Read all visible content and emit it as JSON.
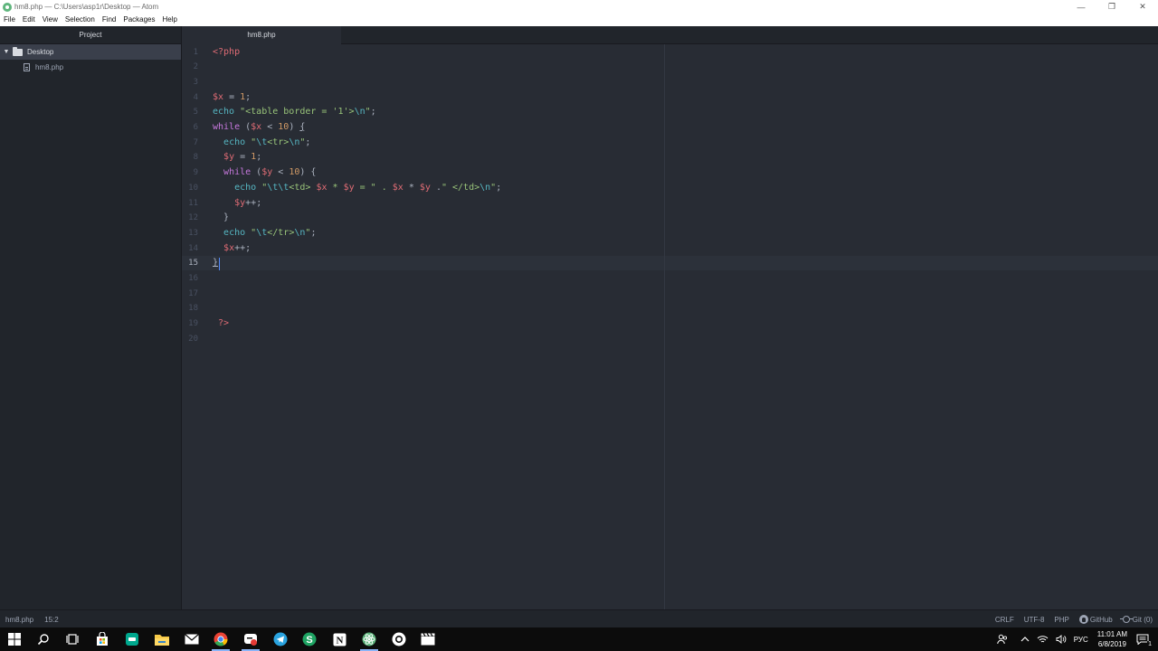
{
  "window": {
    "title": "hm8.php — C:\\Users\\asp1r\\Desktop — Atom",
    "controls": [
      "—",
      "❐",
      "✕"
    ]
  },
  "menu": [
    "File",
    "Edit",
    "View",
    "Selection",
    "Find",
    "Packages",
    "Help"
  ],
  "sidebar": {
    "header": "Project",
    "root": "Desktop",
    "files": [
      "hm8.php"
    ]
  },
  "tabs": [
    {
      "label": "hm8.php",
      "active": true
    }
  ],
  "editor": {
    "line_numbers": [
      "1",
      "2",
      "3",
      "4",
      "5",
      "6",
      "7",
      "8",
      "9",
      "10",
      "11",
      "12",
      "13",
      "14",
      "15",
      "16",
      "17",
      "18",
      "19",
      "20"
    ],
    "active_line": 15,
    "lines": [
      [
        [
          "tag",
          "<?php"
        ]
      ],
      [],
      [],
      [
        [
          "var",
          "$x"
        ],
        [
          "op",
          " = "
        ],
        [
          "num",
          "1"
        ],
        [
          "punc",
          ";"
        ]
      ],
      [
        [
          "fn",
          "echo"
        ],
        [
          "op",
          " "
        ],
        [
          "str",
          "\"<table border = '1'>"
        ],
        [
          "esc",
          "\\n"
        ],
        [
          "str",
          "\""
        ],
        [
          "punc",
          ";"
        ]
      ],
      [
        [
          "kw",
          "while"
        ],
        [
          "op",
          " ("
        ],
        [
          "var",
          "$x"
        ],
        [
          "op",
          " < "
        ],
        [
          "num",
          "10"
        ],
        [
          "op",
          ") "
        ],
        [
          "brace-m",
          "{"
        ]
      ],
      [
        [
          "op",
          "  "
        ],
        [
          "fn",
          "echo"
        ],
        [
          "op",
          " "
        ],
        [
          "str",
          "\""
        ],
        [
          "esc",
          "\\t"
        ],
        [
          "str",
          "<tr>"
        ],
        [
          "esc",
          "\\n"
        ],
        [
          "str",
          "\""
        ],
        [
          "punc",
          ";"
        ]
      ],
      [
        [
          "op",
          "  "
        ],
        [
          "var",
          "$y"
        ],
        [
          "op",
          " = "
        ],
        [
          "num",
          "1"
        ],
        [
          "punc",
          ";"
        ]
      ],
      [
        [
          "op",
          "  "
        ],
        [
          "kw",
          "while"
        ],
        [
          "op",
          " ("
        ],
        [
          "var",
          "$y"
        ],
        [
          "op",
          " < "
        ],
        [
          "num",
          "10"
        ],
        [
          "op",
          ") {"
        ]
      ],
      [
        [
          "op",
          "    "
        ],
        [
          "fn",
          "echo"
        ],
        [
          "op",
          " "
        ],
        [
          "str",
          "\""
        ],
        [
          "esc",
          "\\t\\t"
        ],
        [
          "str",
          "<td> "
        ],
        [
          "var",
          "$x"
        ],
        [
          "str",
          " * "
        ],
        [
          "var",
          "$y"
        ],
        [
          "str",
          " = \" . "
        ],
        [
          "var",
          "$x"
        ],
        [
          "op",
          " * "
        ],
        [
          "var",
          "$y"
        ],
        [
          "op",
          " ."
        ],
        [
          "str",
          "\" </td>"
        ],
        [
          "esc",
          "\\n"
        ],
        [
          "str",
          "\""
        ],
        [
          "punc",
          ";"
        ]
      ],
      [
        [
          "op",
          "    "
        ],
        [
          "var",
          "$y"
        ],
        [
          "op",
          "++"
        ],
        [
          "punc",
          ";"
        ]
      ],
      [
        [
          "op",
          "  }"
        ]
      ],
      [
        [
          "op",
          "  "
        ],
        [
          "fn",
          "echo"
        ],
        [
          "op",
          " "
        ],
        [
          "str",
          "\""
        ],
        [
          "esc",
          "\\t"
        ],
        [
          "str",
          "</tr>"
        ],
        [
          "esc",
          "\\n"
        ],
        [
          "str",
          "\""
        ],
        [
          "punc",
          ";"
        ]
      ],
      [
        [
          "op",
          "  "
        ],
        [
          "var",
          "$x"
        ],
        [
          "op",
          "++"
        ],
        [
          "punc",
          ";"
        ]
      ],
      [
        [
          "brace-m",
          "}"
        ]
      ],
      [],
      [],
      [],
      [
        [
          "op",
          " "
        ],
        [
          "tag",
          "?>"
        ]
      ],
      []
    ]
  },
  "statusbar": {
    "file": "hm8.php",
    "cursor": "15:2",
    "line_ending": "CRLF",
    "encoding": "UTF-8",
    "grammar": "PHP",
    "github": "GitHub",
    "git": "Git (0)"
  },
  "taskbar": {
    "language": "РУС",
    "time": "11:01 AM",
    "date": "6/8/2019",
    "notification_count": "1",
    "colors": {
      "store": "#ffffff",
      "kaspersky": "#00a88e",
      "explorer": "#f7c948",
      "mail": "#ffffff",
      "chrome_red": "#ea4335",
      "chrome_yellow": "#fbbc05",
      "chrome_green": "#34a853",
      "chrome_blue": "#4285f4",
      "telegram": "#2aa3df",
      "s_app": "#1ea362",
      "notion": "#ffffff",
      "atom": "#5fb57d",
      "films": "#ffffff"
    }
  }
}
